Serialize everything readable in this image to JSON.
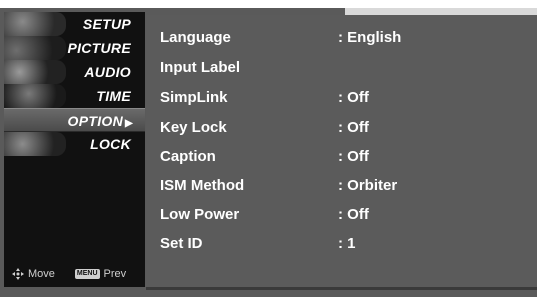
{
  "menu": {
    "items": [
      {
        "label": "SETUP"
      },
      {
        "label": "PICTURE"
      },
      {
        "label": "AUDIO"
      },
      {
        "label": "TIME"
      },
      {
        "label": "OPTION",
        "selected": true
      },
      {
        "label": "LOCK"
      }
    ],
    "hint_move": "Move",
    "hint_key": "MENU",
    "hint_prev": "Prev"
  },
  "settings": [
    {
      "label": "Language",
      "value": ": English"
    },
    {
      "label": "Input Label",
      "value": ""
    },
    {
      "label": "SimpLink",
      "value": ": Off"
    },
    {
      "label": "Key Lock",
      "value": ": Off"
    },
    {
      "label": "Caption",
      "value": ": Off"
    },
    {
      "label": "ISM Method",
      "value": ": Orbiter"
    },
    {
      "label": "Low Power",
      "value": ": Off"
    },
    {
      "label": "Set ID",
      "value": ": 1"
    }
  ],
  "colors": {
    "menu_bg": "#111111",
    "panel_bg": "#5b5b5b",
    "text": "#ffffff"
  }
}
